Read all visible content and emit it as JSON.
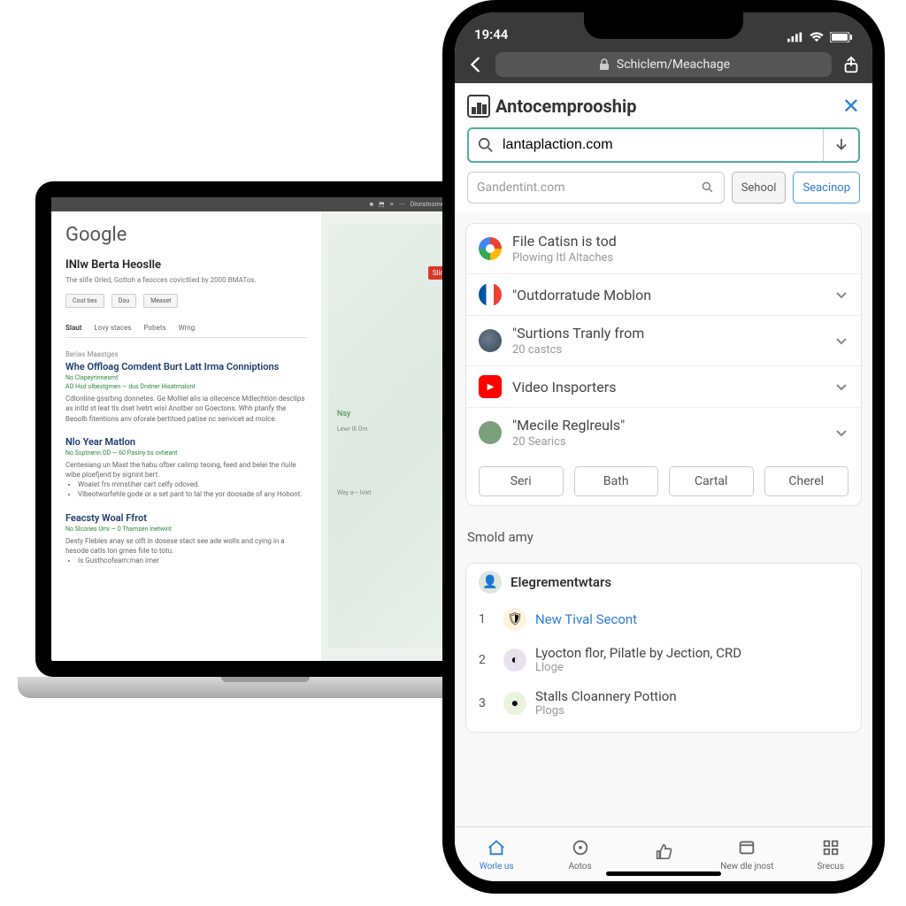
{
  "laptop": {
    "logo": "Google",
    "heading": "INlw Berta Heoslle",
    "subheading": "The slife Orled, Gottoh a feocces covictlied by 2000 BMATos.",
    "chips": [
      "Cout ties",
      "Dou",
      "Measet"
    ],
    "tabs": [
      "Slaut",
      "Lovy staces",
      "Pobets",
      "Wmg"
    ],
    "section1": {
      "cat": "Berias Maastges",
      "title": "Whe Offloag Comdent Burt Latt Irma Conniptions",
      "green1": "No Clapeyrinnesmt",
      "green2": "AO Hsd olbestgmen — dus Dndner Hisatmalont",
      "body": "Cdlonline gssrbng donnetes. Ge Molliel alis ia ollecence Mdlechtion desclips as intld st Ieat tls dset lvetrt wisl Anotber on Goectons. Whh ptanfy the Beoolb fitentions anv oforale bertitoed patise nc senvicet ad molce."
    },
    "section2": {
      "title": "Nlo Year Matlon",
      "green": "No Ssptnenn OD — 60 Pasiny tis ovtieant",
      "body": "Centesiang un Mast the habu ofber calimp teoing, feed and belei the rluile wibe ploefjend by signint bert.",
      "bullets": [
        "Woalet frs mmstiher cart celfy odoved.",
        "Vibeotworfehle gode or a set pant to tal the yor doosade of any Hobont."
      ]
    },
    "section3": {
      "title": "Feacsty Woal Ffrot",
      "green": "No Slcories Umi — 0 Thamsen Inetwint",
      "body": "Desty Flebles anay se olft in dosese stact see ade wolls and cying in a hesode catls Ion gmes fiile to totu.",
      "bullet": "Is Gusthcofeam:man imer"
    },
    "map": {
      "red": "Sline Ine",
      "nsy": "Nsy",
      "lb": "Lewr lll Om",
      "wy": "Wey a— lviet"
    }
  },
  "phone": {
    "time": "19:44",
    "url": "Schiclem/Meachage",
    "brand": "Antocemprooship",
    "search_value": "lantaplaction.com",
    "toolbar_placeholder": "Gandentint.com",
    "toolbar_btn1": "Sehool",
    "toolbar_btn2": "Seacinop",
    "suggestions": [
      {
        "title": "File Catisn is tod",
        "sub": "Plowing Itl Altaches",
        "icon": "chrome",
        "chevron": false
      },
      {
        "title": "\"Outdorratude Moblon",
        "sub": "",
        "icon": "france",
        "chevron": true
      },
      {
        "title": "\"Surtions Tranly from",
        "sub": "20 castcs",
        "icon": "grey",
        "chevron": true
      },
      {
        "title": "Video Insporters",
        "sub": "",
        "icon": "youtube",
        "chevron": true
      },
      {
        "title": "\"Mecile Reglreuls\"",
        "sub": "20 Searics",
        "icon": "globe",
        "chevron": true
      }
    ],
    "chips": [
      "Seri",
      "Bath",
      "Cartal",
      "Cherel"
    ],
    "section_label": "Smold amy",
    "trending_header": "Elegrementwtars",
    "trending": [
      {
        "n": "1",
        "title": "New Tival Secont",
        "sub": "",
        "link": true,
        "icon": "🛡"
      },
      {
        "n": "2",
        "title": "Lyocton flor, Pilatle by Jection, CRD",
        "sub": "Lloge",
        "link": false,
        "icon": "◐"
      },
      {
        "n": "3",
        "title": "Stalls Cloannery Pottion",
        "sub": "Plogs",
        "link": false,
        "icon": "●"
      }
    ],
    "bottom_tabs": [
      {
        "label": "Worle us",
        "icon": "home"
      },
      {
        "label": "Aotos",
        "icon": "circle"
      },
      {
        "label": "",
        "icon": "thumbs"
      },
      {
        "label": "New dle jnost",
        "icon": "tab"
      },
      {
        "label": "Srecus",
        "icon": "grid"
      }
    ]
  }
}
